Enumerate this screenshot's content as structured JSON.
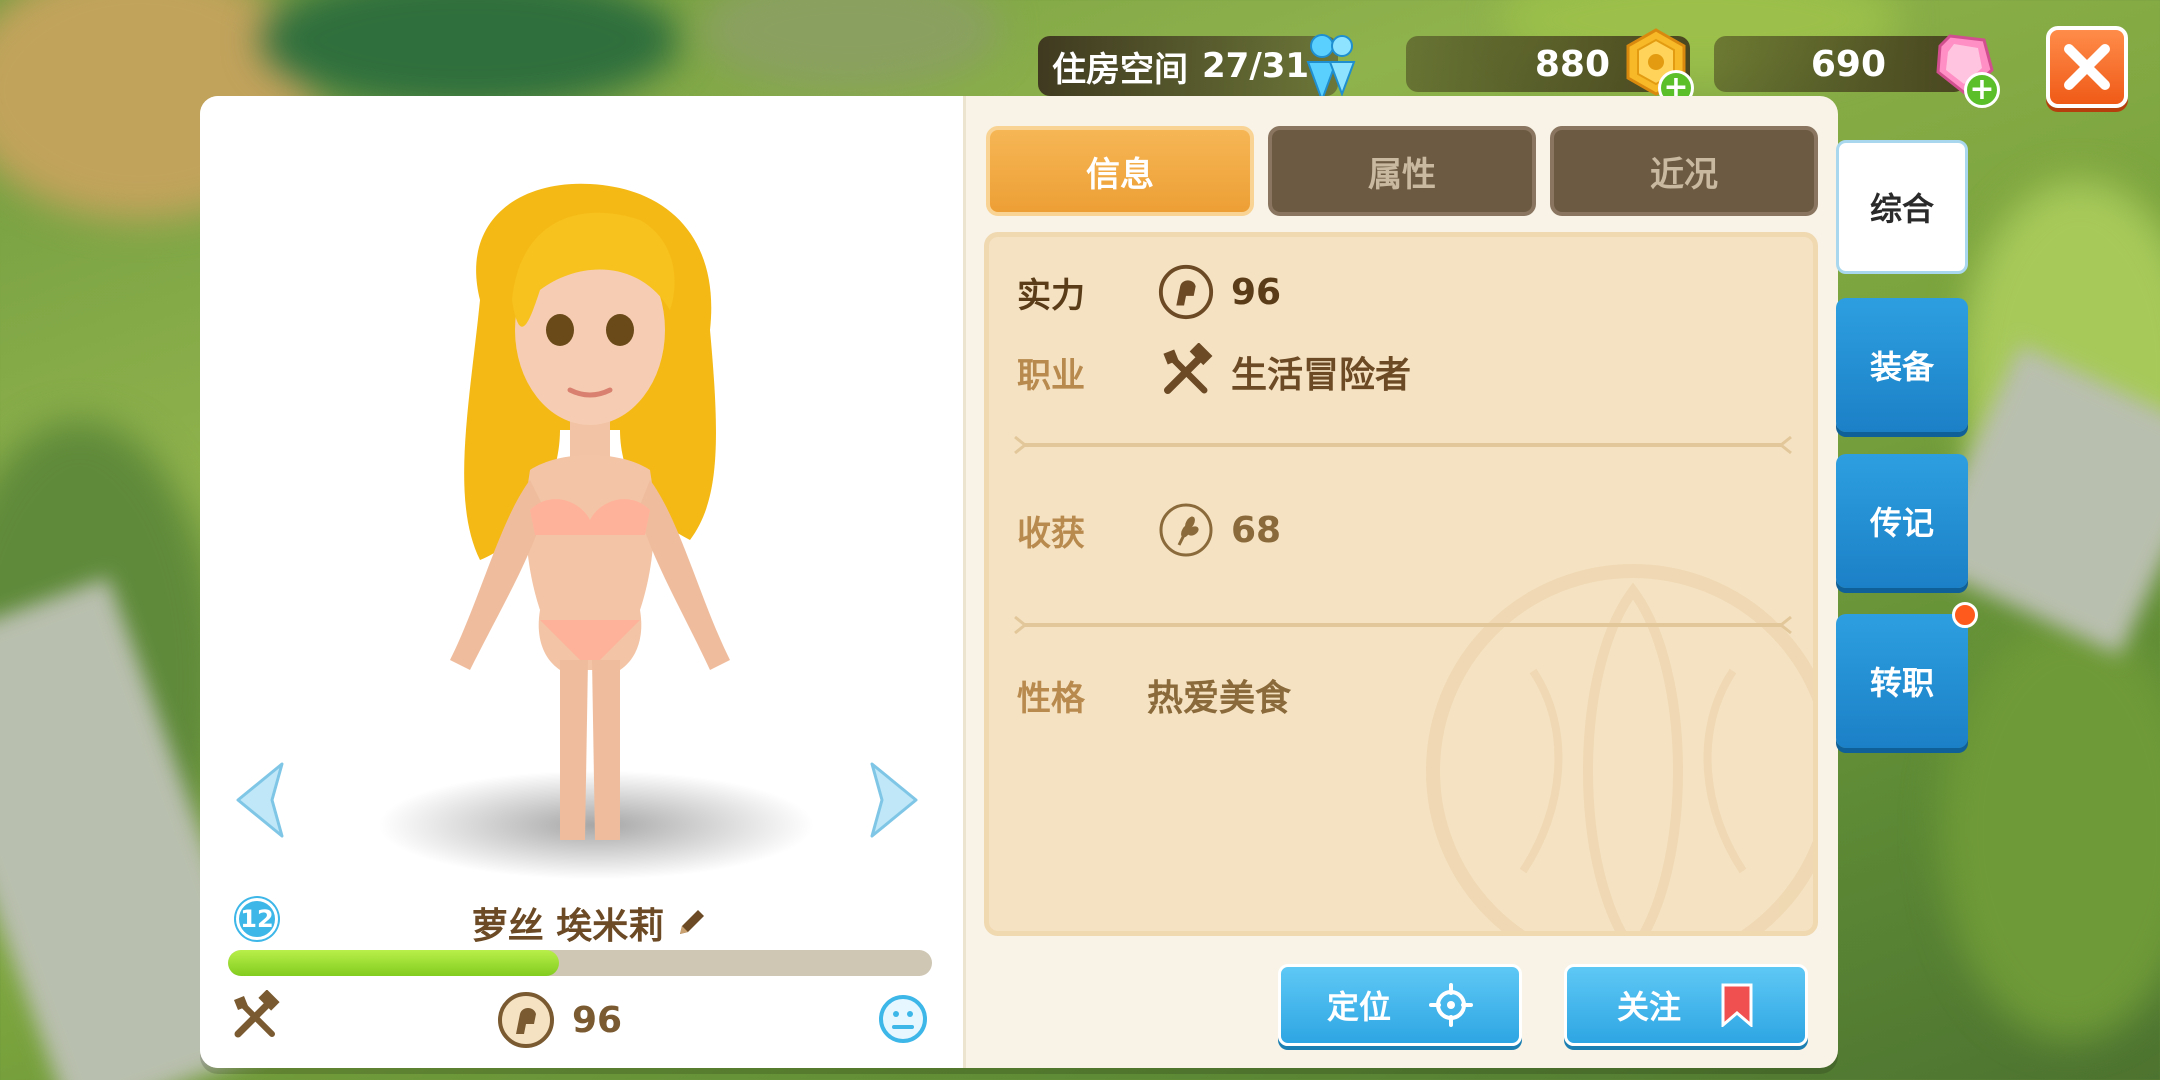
{
  "header": {
    "housing_label": "住房空间",
    "housing_value": "27/31",
    "coins": "880",
    "gems": "690"
  },
  "character": {
    "name": "萝丝 埃米莉",
    "level": "12",
    "xp_fraction": 0.47,
    "power": "96"
  },
  "tabs": [
    {
      "label": "信息",
      "active": true
    },
    {
      "label": "属性",
      "active": false
    },
    {
      "label": "近况",
      "active": false
    }
  ],
  "info": {
    "strength_label": "实力",
    "strength_value": "96",
    "job_label": "职业",
    "job_value": "生活冒险者",
    "harvest_label": "收获",
    "harvest_value": "68",
    "personality_label": "性格",
    "personality_value": "热爱美食"
  },
  "actions": {
    "locate": "定位",
    "follow": "关注"
  },
  "side_tabs": [
    {
      "label": "综合",
      "active": true
    },
    {
      "label": "装备",
      "active": false
    },
    {
      "label": "传记",
      "active": false
    },
    {
      "label": "转职",
      "active": false,
      "notification": true
    }
  ],
  "colors": {
    "accent_orange": "#ed9f35",
    "button_blue": "#2ea6e3",
    "label_brown": "#6b4a25",
    "xp_green": "#82cc1f"
  }
}
